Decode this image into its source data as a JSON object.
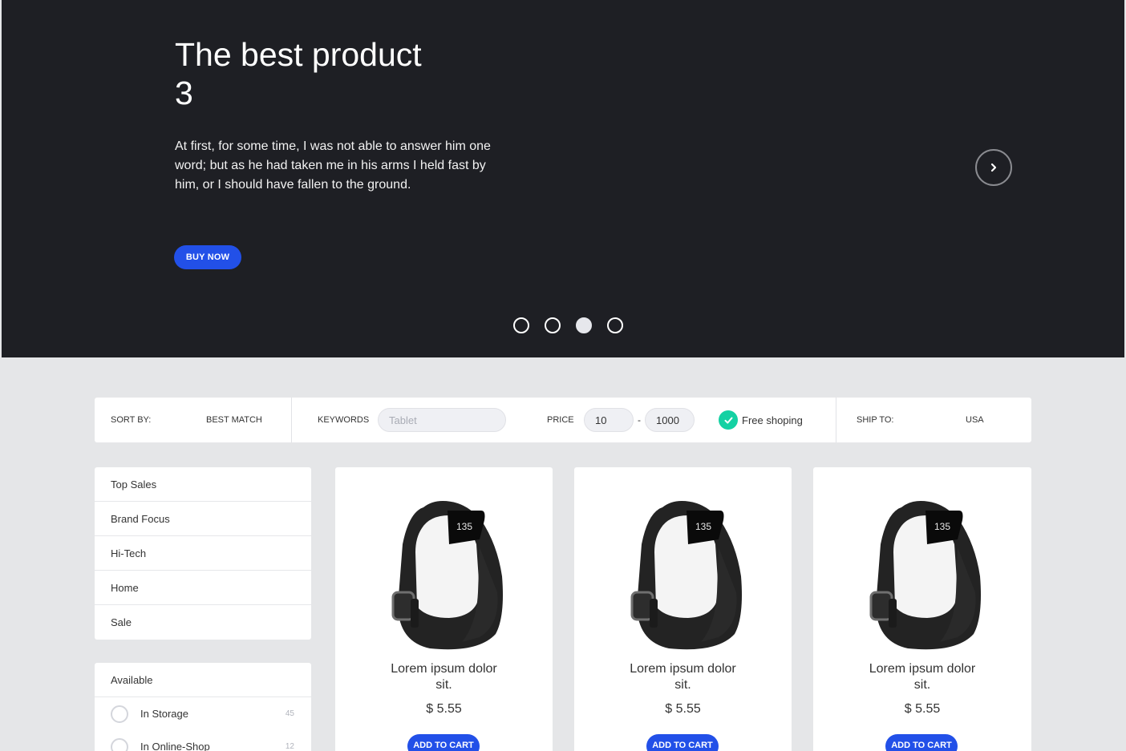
{
  "hero": {
    "title": "The best product 3",
    "text": "At first, for some time, I was not able to answer him one word; but as he had taken me in his arms I held fast by him, or I should have fallen to the ground.",
    "buy_label": "BUY NOW",
    "next_icon": "chevron-right-icon",
    "slides_count": 4,
    "active_slide": 3
  },
  "filters": {
    "sort_label": "SORT BY:",
    "sort_value": "BEST MATCH",
    "keywords_label": "KEYWORDS",
    "keywords_placeholder": "Tablet",
    "price_label": "PRICE",
    "price_min": "10",
    "price_sep": "-",
    "price_max": "1000",
    "free_shipping_label": "Free shoping",
    "free_shipping_checked": true,
    "ship_label": "SHIP TO:",
    "ship_value": "USA"
  },
  "sidebar": {
    "categories": [
      "Top Sales",
      "Brand Focus",
      "Hi-Tech",
      "Home",
      "Sale"
    ],
    "availability": {
      "title": "Available",
      "options": [
        {
          "label": "In Storage",
          "count": "45"
        },
        {
          "label": "In Online-Shop",
          "count": "12"
        }
      ]
    }
  },
  "products": [
    {
      "name": "Lorem ipsum dolor sit.",
      "price": "$ 5.55",
      "cart_label": "ADD TO CART",
      "watch_display": "135"
    },
    {
      "name": "Lorem ipsum dolor sit.",
      "price": "$ 5.55",
      "cart_label": "ADD TO CART",
      "watch_display": "135"
    },
    {
      "name": "Lorem ipsum dolor sit.",
      "price": "$ 5.55",
      "cart_label": "ADD TO CART",
      "watch_display": "135"
    }
  ],
  "colors": {
    "hero_bg": "#1e1f24",
    "accent_blue": "#2250e8",
    "check_green": "#14d1a3",
    "page_bg": "#e5e6e8"
  }
}
